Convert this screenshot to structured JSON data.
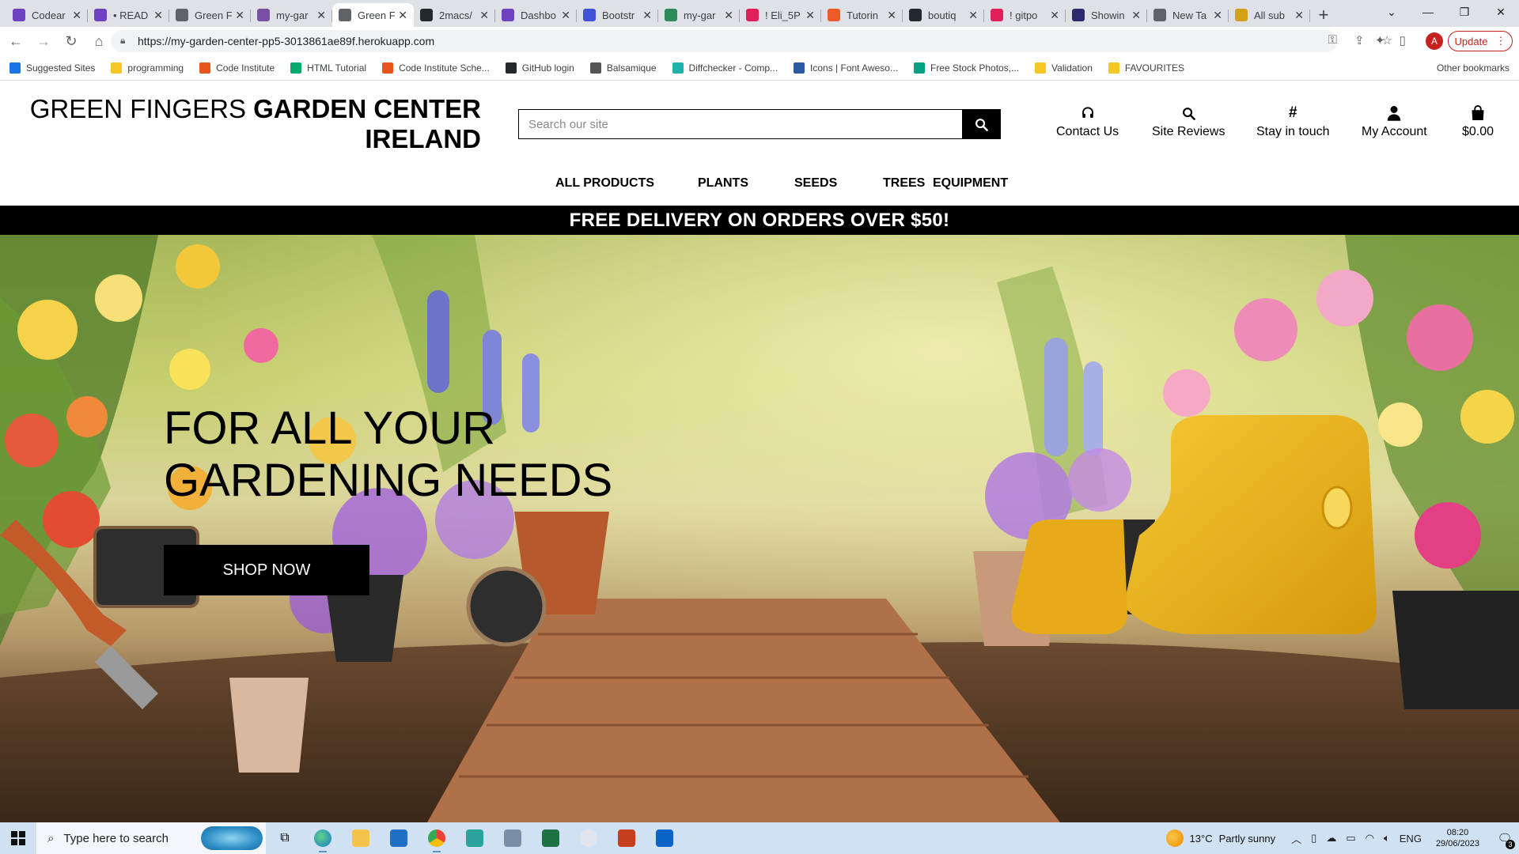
{
  "browser": {
    "tabs": [
      {
        "title": "Codear",
        "color": "#6f42c1",
        "active": false
      },
      {
        "title": "• READ",
        "color": "#6f42c1",
        "active": false
      },
      {
        "title": "Green F",
        "color": "#5f6368",
        "active": false
      },
      {
        "title": "my-gar",
        "color": "#7b4fa3",
        "active": false
      },
      {
        "title": "Green F",
        "color": "#5f6368",
        "active": true
      },
      {
        "title": "2macs/",
        "color": "#24292e",
        "active": false
      },
      {
        "title": "Dashbo",
        "color": "#6f42c1",
        "active": false
      },
      {
        "title": "Bootstr",
        "color": "#4052d6",
        "active": false
      },
      {
        "title": "my-gar",
        "color": "#2e8b57",
        "active": false
      },
      {
        "title": "! Eli_5P",
        "color": "#e01e5a",
        "active": false
      },
      {
        "title": "Tutorin",
        "color": "#f05a28",
        "active": false
      },
      {
        "title": "boutiq",
        "color": "#24292e",
        "active": false
      },
      {
        "title": "! gitpo",
        "color": "#e01e5a",
        "active": false
      },
      {
        "title": "Showin",
        "color": "#2b2b6b",
        "active": false
      },
      {
        "title": "New Ta",
        "color": "#5f6368",
        "active": false
      },
      {
        "title": "All sub",
        "color": "#d4a017",
        "active": false
      }
    ],
    "url": "https://my-garden-center-pp5-3013861ae89f.herokuapp.com",
    "update_label": "Update",
    "avatar_letter": "A",
    "bookmarks": [
      {
        "label": "Suggested Sites",
        "color": "#1a73e8"
      },
      {
        "label": "programming",
        "color": "#f6c624"
      },
      {
        "label": "Code Institute",
        "color": "#e8541c"
      },
      {
        "label": "HTML Tutorial",
        "color": "#04aa6d"
      },
      {
        "label": "Code Institute Sche...",
        "color": "#e8541c"
      },
      {
        "label": "GitHub login",
        "color": "#24292e"
      },
      {
        "label": "Balsamique",
        "color": "#555555"
      },
      {
        "label": "Diffchecker - Comp...",
        "color": "#20b2aa"
      },
      {
        "label": "Icons | Font Aweso...",
        "color": "#2c5aa0"
      },
      {
        "label": "Free Stock Photos,...",
        "color": "#05a081"
      },
      {
        "label": "Validation",
        "color": "#f6c624"
      },
      {
        "label": "FAVOURITES",
        "color": "#f6c624"
      }
    ],
    "other_bookmarks": "Other bookmarks"
  },
  "site": {
    "brand_light": "GREEN FINGERS",
    "brand_bold_1": "GARDEN CENTER",
    "brand_bold_2": "IRELAND",
    "search_placeholder": "Search our site",
    "header_links": [
      {
        "label": "Contact Us",
        "icon": "headset-icon"
      },
      {
        "label": "Site Reviews",
        "icon": "search-icon"
      },
      {
        "label": "Stay in touch",
        "icon": "hashtag-icon"
      },
      {
        "label": "My Account",
        "icon": "user-icon"
      },
      {
        "label": "$0.00",
        "icon": "shopping-bag-icon"
      }
    ],
    "nav": [
      "ALL PRODUCTS",
      "PLANTS",
      "SEEDS",
      "TREES",
      "EQUIPMENT"
    ],
    "promo": "FREE DELIVERY ON ORDERS OVER $50!",
    "hero_title": "FOR ALL YOUR GARDENING NEEDS",
    "hero_button": "SHOP NOW"
  },
  "taskbar": {
    "search_placeholder": "Type here to search",
    "weather_temp": "13°C",
    "weather_desc": "Partly sunny",
    "language": "ENG",
    "time": "08:20",
    "date": "29/06/2023",
    "notification_count": "3"
  }
}
